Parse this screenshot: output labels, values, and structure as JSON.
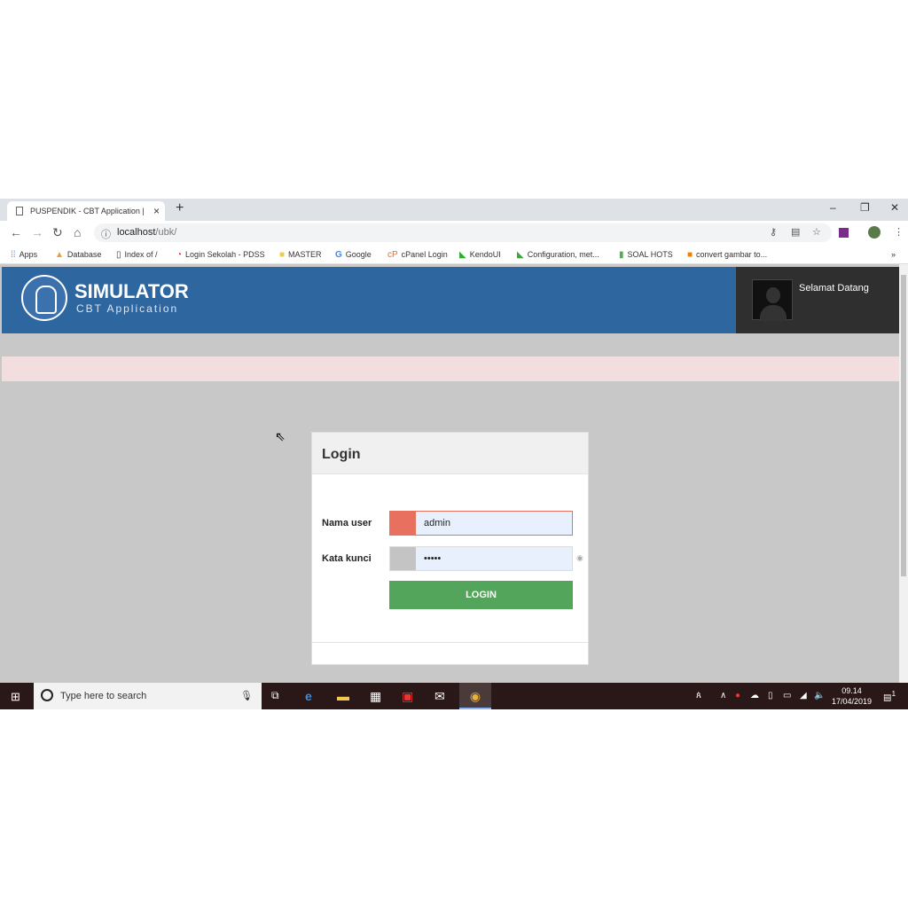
{
  "browser": {
    "tab_title": "PUSPENDIK - CBT Application |",
    "url_host": "localhost",
    "url_path": "/ubk/",
    "bookmarks": [
      {
        "label": "Apps",
        "icon": "apps-grid-icon"
      },
      {
        "label": "Database",
        "icon": "database-icon"
      },
      {
        "label": "Index of /",
        "icon": "page-icon"
      },
      {
        "label": "Login Sekolah - PDSS",
        "icon": "pdss-icon"
      },
      {
        "label": "MASTER",
        "icon": "folder-icon"
      },
      {
        "label": "Google",
        "icon": "google-icon"
      },
      {
        "label": "cPanel Login",
        "icon": "cpanel-icon"
      },
      {
        "label": "KendoUI",
        "icon": "kendo-icon"
      },
      {
        "label": "Configuration, met...",
        "icon": "kendo-icon"
      },
      {
        "label": "SOAL HOTS",
        "icon": "book-icon"
      },
      {
        "label": "convert gambar to...",
        "icon": "blogger-icon"
      }
    ]
  },
  "app": {
    "title": "SIMULATOR",
    "subtitle": "CBT Application",
    "welcome": "Selamat Datang",
    "header_color": "#2e66a0"
  },
  "login": {
    "heading": "Login",
    "username_label": "Nama user",
    "username_value": "admin",
    "password_label": "Kata kunci",
    "password_value": "•••••",
    "button": "LOGIN",
    "button_color": "#52a55a",
    "user_addon_color": "#e8705f"
  },
  "taskbar": {
    "search_placeholder": "Type here to search",
    "time": "09.14",
    "date": "17/04/2019",
    "notifications": "1"
  }
}
